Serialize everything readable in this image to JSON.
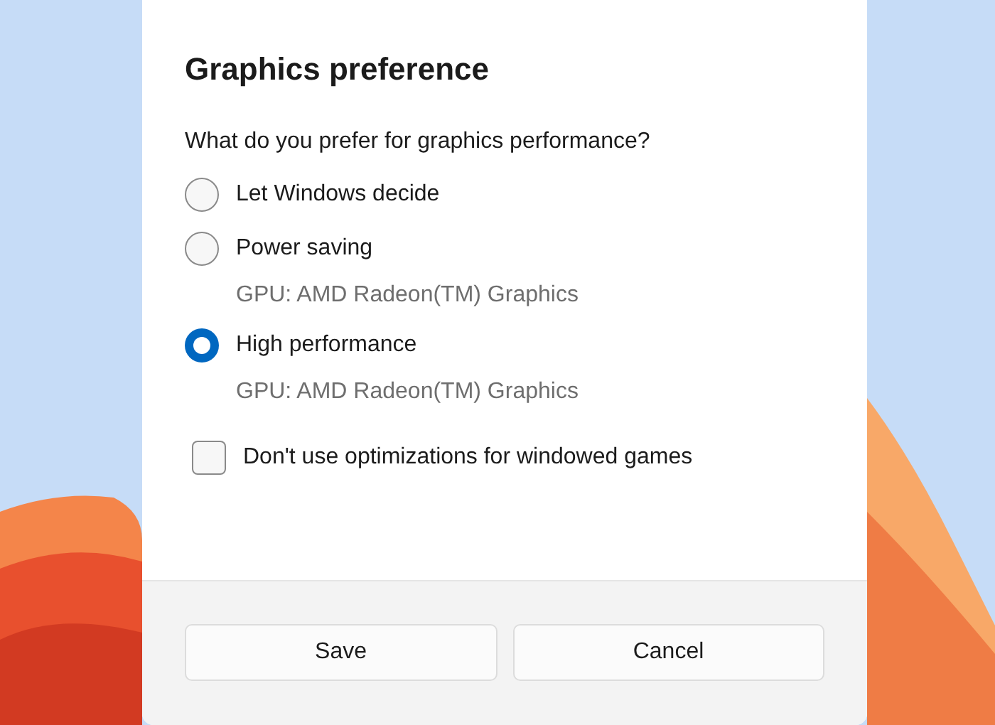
{
  "dialog": {
    "title": "Graphics preference",
    "question": "What do you prefer for graphics performance?",
    "options": [
      {
        "label": "Let Windows decide",
        "selected": false
      },
      {
        "label": "Power saving",
        "detail": "GPU: AMD Radeon(TM) Graphics",
        "selected": false
      },
      {
        "label": "High performance",
        "detail": "GPU: AMD Radeon(TM) Graphics",
        "selected": true
      }
    ],
    "checkbox": {
      "label": "Don't use optimizations for windowed games",
      "checked": false
    },
    "buttons": [
      "Save",
      "Cancel"
    ]
  }
}
